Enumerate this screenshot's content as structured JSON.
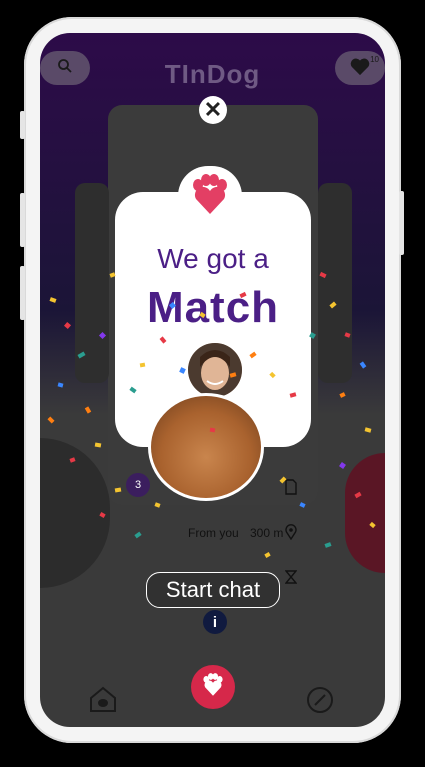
{
  "header": {
    "app_title": "TInDog",
    "like_count": "10"
  },
  "match_card": {
    "line1": "We got a",
    "line2": "Match"
  },
  "profile_details": {
    "count_badge": "3",
    "from_label": "From you",
    "distance": "300 m"
  },
  "actions": {
    "start_chat_label": "Start chat",
    "info_label": "i"
  },
  "icons": {
    "search": "search-icon",
    "heart": "heart-icon",
    "close": "close-icon",
    "paw": "paw-icon",
    "home": "home-icon",
    "profile": "profile-icon"
  },
  "colors": {
    "brand": "#4b1f86",
    "accent": "#e33f64",
    "confetti": [
      "#f4c430",
      "#e63946",
      "#2a9d8f",
      "#3a86ff",
      "#ff7f11",
      "#8338ec"
    ]
  }
}
